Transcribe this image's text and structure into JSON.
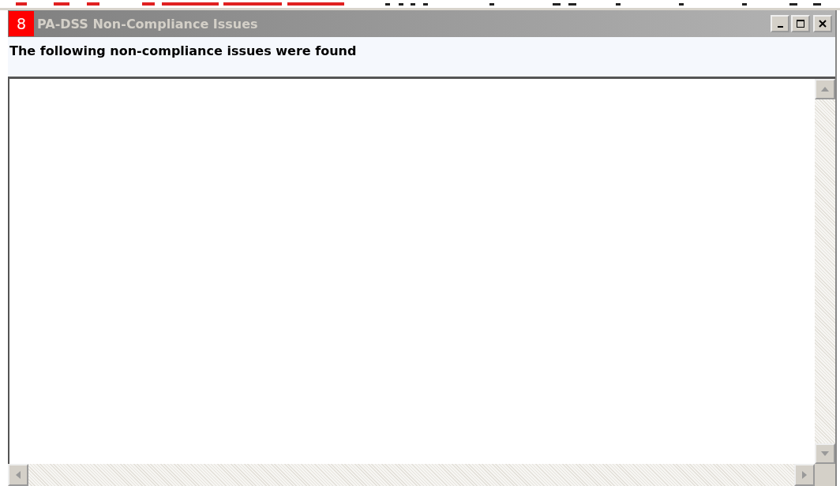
{
  "window": {
    "icon_text": "8",
    "title": "PA-DSS Non-Compliance Issues",
    "active": false
  },
  "message": "The following non-compliance issues were found"
}
